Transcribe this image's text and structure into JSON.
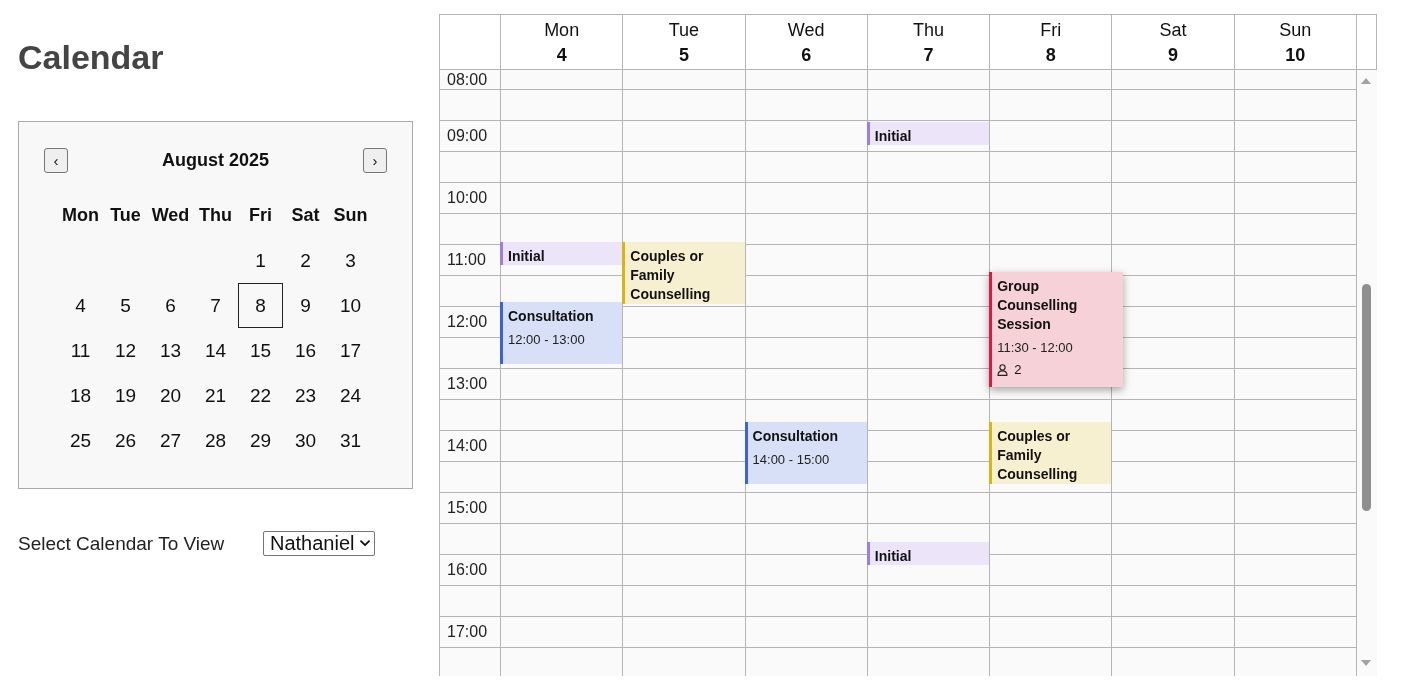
{
  "page": {
    "title": "Calendar"
  },
  "mini_calendar": {
    "prev": "‹",
    "month": "August 2025",
    "next": "›",
    "weekdays": [
      "Mon",
      "Tue",
      "Wed",
      "Thu",
      "Fri",
      "Sat",
      "Sun"
    ],
    "weeks": [
      {
        "fri": {
          "label": "1",
          "selected": false
        },
        "sat": {
          "label": "2",
          "selected": false
        },
        "sun": {
          "label": "3",
          "selected": false
        }
      },
      {
        "mon": {
          "label": "4",
          "selected": false
        },
        "tue": {
          "label": "5",
          "selected": false
        },
        "wed": {
          "label": "6",
          "selected": false
        },
        "thu": {
          "label": "7",
          "selected": false
        },
        "fri": {
          "label": "8",
          "selected": true
        },
        "sat": {
          "label": "9",
          "selected": false
        },
        "sun": {
          "label": "10",
          "selected": false
        }
      },
      {
        "mon": {
          "label": "11",
          "selected": false
        },
        "tue": {
          "label": "12",
          "selected": false
        },
        "wed": {
          "label": "13",
          "selected": false
        },
        "thu": {
          "label": "14",
          "selected": false
        },
        "fri": {
          "label": "15",
          "selected": false
        },
        "sat": {
          "label": "16",
          "selected": false
        },
        "sun": {
          "label": "17",
          "selected": false
        }
      },
      {
        "mon": {
          "label": "18",
          "selected": false
        },
        "tue": {
          "label": "19",
          "selected": false
        },
        "wed": {
          "label": "20",
          "selected": false
        },
        "thu": {
          "label": "21",
          "selected": false
        },
        "fri": {
          "label": "22",
          "selected": false
        },
        "sat": {
          "label": "23",
          "selected": false
        },
        "sun": {
          "label": "24",
          "selected": false
        }
      },
      {
        "mon": {
          "label": "25",
          "selected": false
        },
        "tue": {
          "label": "26",
          "selected": false
        },
        "wed": {
          "label": "27",
          "selected": false
        },
        "thu": {
          "label": "28",
          "selected": false
        },
        "fri": {
          "label": "29",
          "selected": false
        },
        "sat": {
          "label": "30",
          "selected": false
        },
        "sun": {
          "label": "31",
          "selected": false
        }
      }
    ]
  },
  "calendar_picker": {
    "label": "Select Calendar To View",
    "value": "Nathaniel"
  },
  "week": {
    "days": [
      {
        "name": "Mon",
        "date": "4"
      },
      {
        "name": "Tue",
        "date": "5"
      },
      {
        "name": "Wed",
        "date": "6"
      },
      {
        "name": "Thu",
        "date": "7"
      },
      {
        "name": "Fri",
        "date": "8"
      },
      {
        "name": "Sat",
        "date": "9"
      },
      {
        "name": "Sun",
        "date": "10"
      }
    ],
    "hours": [
      {
        "label": "08:00"
      },
      {
        "label": "09:00",
        "events": {
          "thu": [
            {
              "kind": "brief",
              "title": "Initial",
              "color": "#a07ce0",
              "expanded": false
            }
          ]
        }
      },
      {
        "label": "10:00"
      },
      {
        "label": "11:00",
        "events": {
          "mon": [
            {
              "kind": "brief",
              "title": "Initial",
              "color": "#a07ce0",
              "expanded": false
            }
          ],
          "tue": [
            {
              "kind": "block",
              "title": "Couples or Family Counselling",
              "color": "#d9b512",
              "expanded": false
            }
          ],
          "fri": [
            {
              "kind": "block",
              "title": "Group Counselling Session",
              "time": "11:30 - 12:00",
              "attendees": "2",
              "color": "#d81b3c",
              "expanded": true,
              "half_past": true
            }
          ]
        }
      },
      {
        "label": "12:00",
        "events": {
          "mon": [
            {
              "kind": "block",
              "title": "Consultation",
              "time": "12:00 - 13:00",
              "color": "#3b62d9",
              "expanded": false
            }
          ]
        }
      },
      {
        "label": "13:00"
      },
      {
        "label": "14:00",
        "events": {
          "wed": [
            {
              "kind": "block",
              "title": "Consultation",
              "time": "14:00 - 15:00",
              "color": "#3b62d9",
              "expanded": false
            }
          ],
          "fri": [
            {
              "kind": "block",
              "title": "Couples or Family Counselling",
              "color": "#d9b512",
              "expanded": false
            }
          ]
        }
      },
      {
        "label": "15:00"
      },
      {
        "label": "16:00",
        "events": {
          "thu": [
            {
              "kind": "brief",
              "title": "Initial",
              "color": "#a07ce0",
              "expanded": false
            }
          ]
        }
      },
      {
        "label": "17:00"
      }
    ]
  }
}
